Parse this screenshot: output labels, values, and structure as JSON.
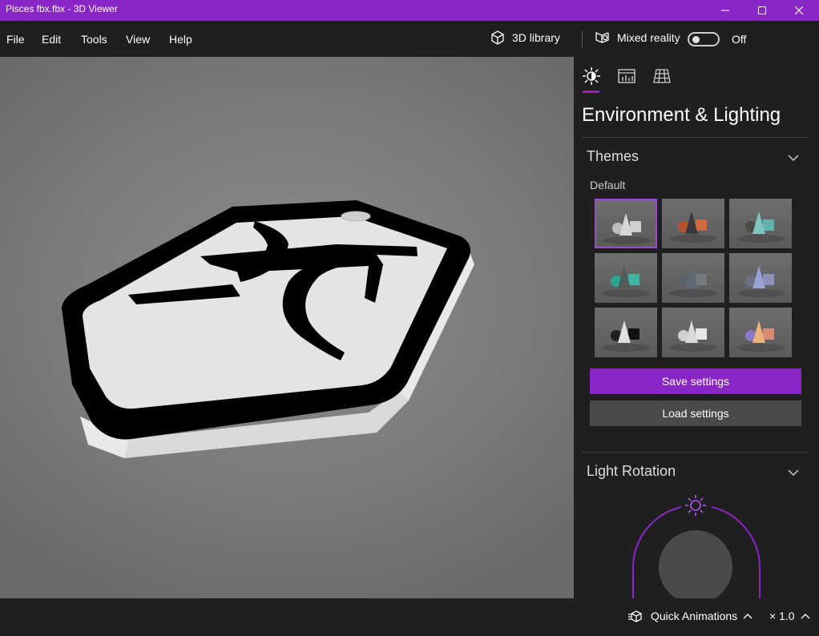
{
  "window": {
    "title": "Pisces fbx.fbx - 3D Viewer",
    "controls": [
      "minimize-icon",
      "maximize-icon",
      "close-icon"
    ]
  },
  "menu": {
    "items": [
      "File",
      "Edit",
      "Tools",
      "View",
      "Help"
    ]
  },
  "toolbar": {
    "library_label": "3D library",
    "library_icon": "cube-icon",
    "mixed_reality_label": "Mixed reality",
    "mixed_reality_icon": "mixed-reality-icon",
    "mixed_reality_state": "Off",
    "mixed_reality_on": false
  },
  "panel": {
    "tabs": [
      {
        "icon": "sun-icon",
        "selected": true
      },
      {
        "icon": "stats-icon",
        "selected": false
      },
      {
        "icon": "grid-icon",
        "selected": false
      }
    ],
    "title": "Environment & Lighting",
    "themes": {
      "heading": "Themes",
      "default_label": "Default",
      "selected_index": 0,
      "items": [
        {
          "cone": "#d8d8d8",
          "cube": "#cfcfcf",
          "sphere": "#bdbdbd"
        },
        {
          "cone": "#3a3a3a",
          "cube": "#d2693e",
          "sphere": "#b9512e"
        },
        {
          "cone": "#7fc4bf",
          "cube": "#5fb3ab",
          "sphere": "#4a4a4a"
        },
        {
          "cone": "#4e5c5a",
          "cube": "#3fb5a2",
          "sphere": "#2fa58e"
        },
        {
          "cone": "#606a75",
          "cube": "#747a80",
          "sphere": "#5a6068"
        },
        {
          "cone": "#9aa1d4",
          "cube": "#8b90b8",
          "sphere": "#6c6f85"
        },
        {
          "cone": "#e0e0e0",
          "cube": "#111111",
          "sphere": "#202020"
        },
        {
          "cone": "#dadada",
          "cube": "#e6e6e6",
          "sphere": "#cfcfcf"
        },
        {
          "cone": "#e8b27a",
          "cube": "#d88a73",
          "sphere": "#8a78c9"
        }
      ]
    },
    "save_label": "Save settings",
    "load_label": "Load settings",
    "light_rotation_heading": "Light Rotation"
  },
  "statusbar": {
    "quick_animations_label": "Quick Animations",
    "speed_label": "× 1.0"
  },
  "colors": {
    "accent": "#8a25c6",
    "panel_bg": "#1f1f1f",
    "viewport_bg": "#7c7c7c"
  }
}
